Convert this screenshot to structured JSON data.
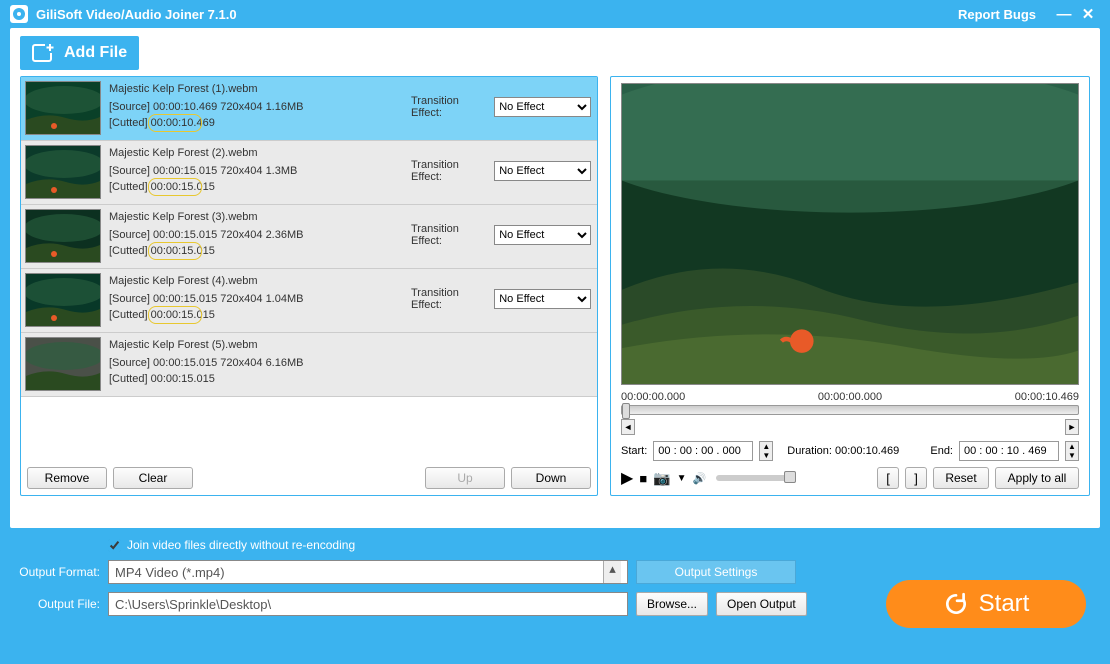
{
  "title": "GiliSoft Video/Audio Joiner 7.1.0",
  "report": "Report Bugs",
  "addFile": "Add File",
  "files": [
    {
      "name": "Majestic Kelp Forest (1).webm",
      "src": "[Source]  00:00:10.469  720x404  1.16MB",
      "cut": "[Cutted]  ",
      "cutTime": "00:00:10",
      "cutRest": ".469",
      "trans": true,
      "sel": true
    },
    {
      "name": "Majestic Kelp Forest (2).webm",
      "src": "[Source]  00:00:15.015  720x404  1.3MB",
      "cut": "[Cutted]  ",
      "cutTime": "00:00:15",
      "cutRest": ".015",
      "trans": true,
      "sel": false
    },
    {
      "name": "Majestic Kelp Forest (3).webm",
      "src": "[Source]  00:00:15.015  720x404  2.36MB",
      "cut": "[Cutted]  ",
      "cutTime": "00:00:15",
      "cutRest": ".015",
      "trans": true,
      "sel": false
    },
    {
      "name": "Majestic Kelp Forest (4).webm",
      "src": "[Source]  00:00:15.015  720x404  1.04MB",
      "cut": "[Cutted]  ",
      "cutTime": "00:00:15",
      "cutRest": ".015",
      "trans": true,
      "sel": false
    },
    {
      "name": "Majestic Kelp Forest (5).webm",
      "src": "[Source]  00:00:15.015  720x404  6.16MB",
      "cut": "[Cutted]  00:00:15.015",
      "cutTime": "",
      "cutRest": "",
      "trans": false,
      "sel": false
    }
  ],
  "transLabel": "Transition Effect:",
  "transValue": "No Effect",
  "buttons": {
    "remove": "Remove",
    "clear": "Clear",
    "up": "Up",
    "down": "Down",
    "reset": "Reset",
    "applyAll": "Apply to all",
    "browse": "Browse...",
    "openOutput": "Open Output",
    "outputSettings": "Output Settings",
    "start": "Start"
  },
  "preview": {
    "t0": "00:00:00.000",
    "t1": "00:00:00.000",
    "t2": "00:00:10.469",
    "startLbl": "Start:",
    "startVal": "00 : 00 : 00 . 000",
    "durLbl": "Duration: 00:00:10.469",
    "endLbl": "End:",
    "endVal": "00 : 00 : 10 . 469"
  },
  "joinDirect": "Join video files directly without re-encoding",
  "outputFormatLbl": "Output Format:",
  "outputFormat": "MP4 Video (*.mp4)",
  "outputFileLbl": "Output File:",
  "outputFile": "C:\\Users\\Sprinkle\\Desktop\\"
}
